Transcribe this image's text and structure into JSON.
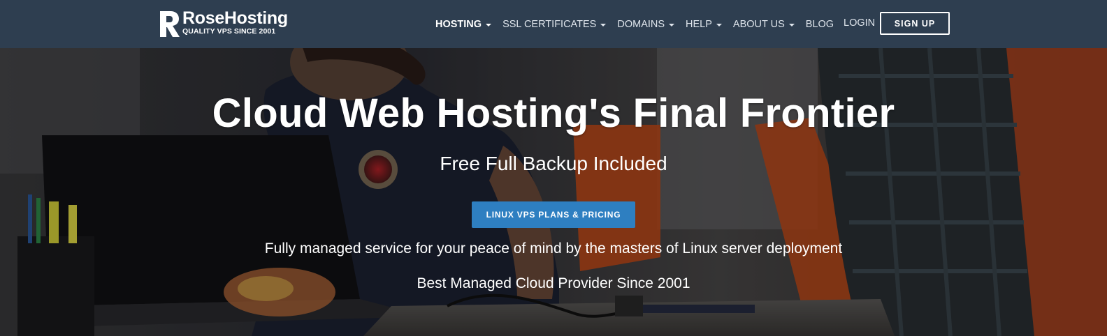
{
  "header": {
    "logo": {
      "name": "RoseHosting",
      "tagline": "QUALITY VPS SINCE 2001",
      "mark_letter": "R"
    },
    "nav": [
      {
        "label": "HOSTING",
        "has_dropdown": true,
        "active": true
      },
      {
        "label": "SSL CERTIFICATES",
        "has_dropdown": true
      },
      {
        "label": "DOMAINS",
        "has_dropdown": true
      },
      {
        "label": "HELP",
        "has_dropdown": true
      },
      {
        "label": "ABOUT US",
        "has_dropdown": true
      },
      {
        "label": "BLOG",
        "has_dropdown": false
      }
    ],
    "login_label": "LOGIN",
    "signup_label": "SIGN UP"
  },
  "hero": {
    "title": "Cloud Web Hosting's Final Frontier",
    "subtitle": "Free Full Backup Included",
    "cta_label": "LINUX VPS PLANS & PRICING",
    "line1": "Fully managed service for your peace of mind by the masters of Linux server deployment",
    "line2": "Best Managed Cloud Provider Since 2001"
  },
  "colors": {
    "header_bg": "#2e3e50",
    "cta_bg": "#2e7fc1",
    "text": "#ffffff"
  }
}
